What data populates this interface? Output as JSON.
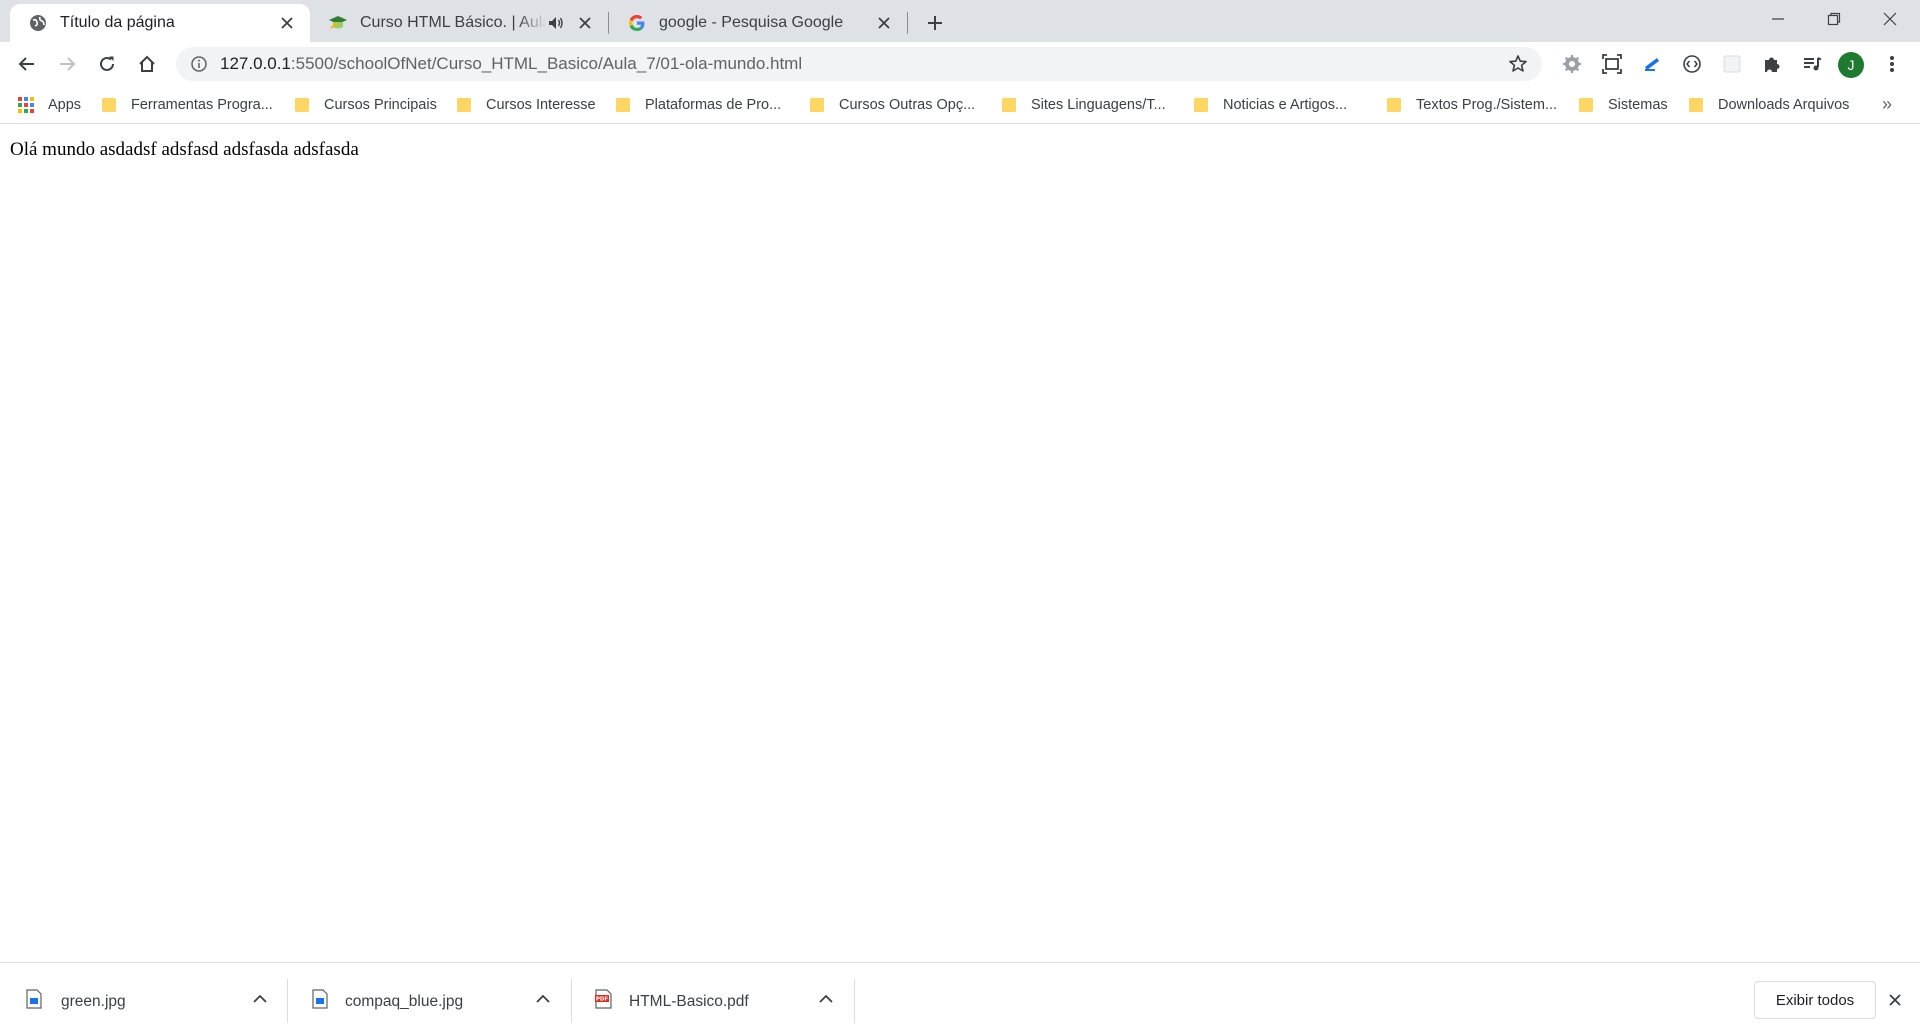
{
  "tabs": [
    {
      "title": "Título da página",
      "icon": "globe-icon",
      "active": true
    },
    {
      "title": "Curso HTML Básico. | Aula Pr",
      "icon": "school-of-net-icon",
      "audio": true,
      "active": false
    },
    {
      "title": "google - Pesquisa Google",
      "icon": "google-g-icon",
      "active": false
    }
  ],
  "omnibox": {
    "host": "127.0.0.1",
    "rest": ":5500/schoolOfNet/Curso_HTML_Basico/Aula_7/01-ola-mundo.html"
  },
  "profile": {
    "initial": "J",
    "color": "#1e7a2f"
  },
  "bookmarks": {
    "apps_label": "Apps",
    "items": [
      {
        "label": "Ferramentas Progra..."
      },
      {
        "label": "Cursos Principais"
      },
      {
        "label": "Cursos Interesse"
      },
      {
        "label": "Plataformas de Pro..."
      },
      {
        "label": "Cursos Outras Opç..."
      },
      {
        "label": "Sites Linguagens/T..."
      },
      {
        "label": "Noticias e Artigos..."
      },
      {
        "label": "Textos Prog./Sistem..."
      },
      {
        "label": "Sistemas"
      },
      {
        "label": "Downloads Arquivos"
      }
    ],
    "overflow": "»"
  },
  "page": {
    "text": "Olá mundo asdadsf adsfasd adsfasda adsfasda"
  },
  "downloads": {
    "items": [
      {
        "name": "green.jpg",
        "icon": "image-file-icon"
      },
      {
        "name": "compaq_blue.jpg",
        "icon": "image-file-icon"
      },
      {
        "name": "HTML-Basico.pdf",
        "icon": "pdf-file-icon"
      }
    ],
    "show_all_label": "Exibir todos"
  },
  "colors": {
    "tabstrip": "#dee1e6",
    "folder": "#fdd663",
    "accent": "#1a73e8"
  }
}
